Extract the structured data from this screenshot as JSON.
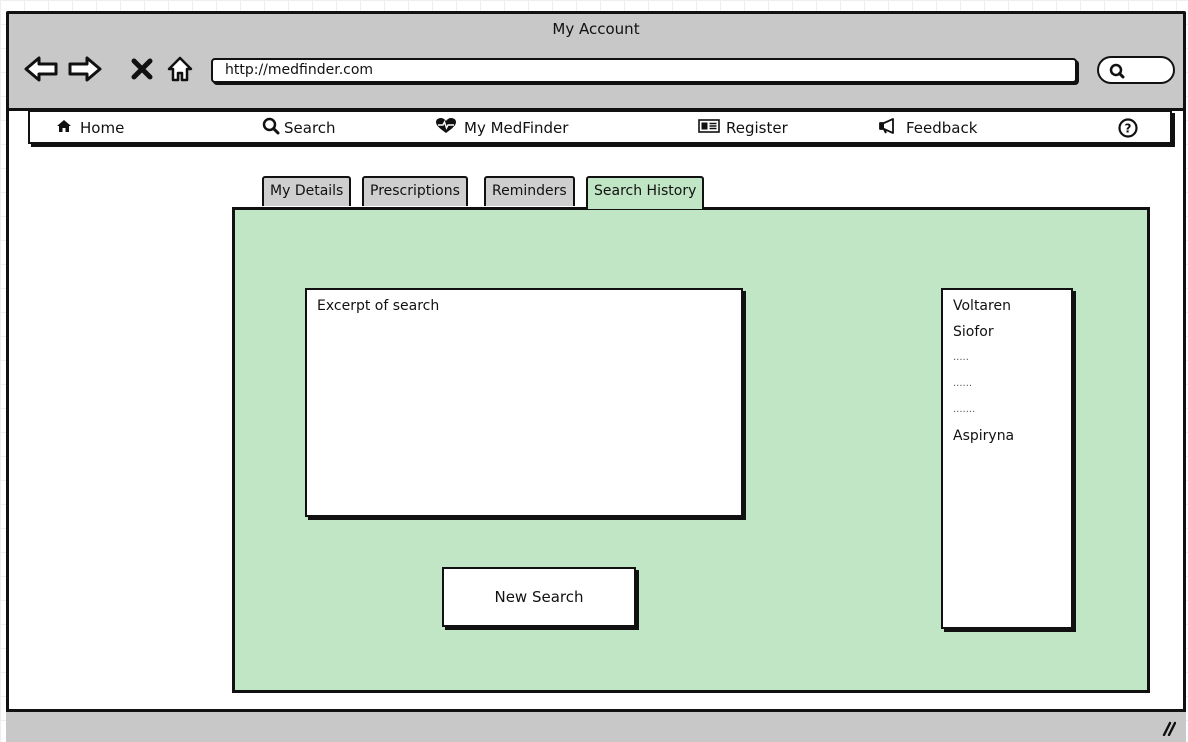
{
  "window": {
    "title": "My Account"
  },
  "browser": {
    "url": "http://medfinder.com",
    "nav_icons": [
      "back-arrow-icon",
      "forward-arrow-icon",
      "stop-icon",
      "home-icon"
    ],
    "search_icon": "search-icon"
  },
  "menu": {
    "items": [
      {
        "label": "Home",
        "icon": "home-icon"
      },
      {
        "label": "Search",
        "icon": "search-icon"
      },
      {
        "label": "My MedFinder",
        "icon": "heartbeat-icon"
      },
      {
        "label": "Register",
        "icon": "id-card-icon"
      },
      {
        "label": "Feedback",
        "icon": "megaphone-icon"
      }
    ],
    "help_icon": "help-icon"
  },
  "tabs": [
    {
      "label": "My Details",
      "active": false
    },
    {
      "label": "Prescriptions",
      "active": false
    },
    {
      "label": "Reminders",
      "active": false
    },
    {
      "label": "Search History",
      "active": true
    }
  ],
  "panel": {
    "excerpt_text": "Excerpt of search",
    "new_search_label": "New Search",
    "history": [
      "Voltaren",
      "Siofor",
      ".....",
      "......",
      ".......",
      "Aspiryna"
    ]
  },
  "colors": {
    "panel_bg": "#c1e6c5",
    "chrome_bg": "#c8c8c8"
  }
}
